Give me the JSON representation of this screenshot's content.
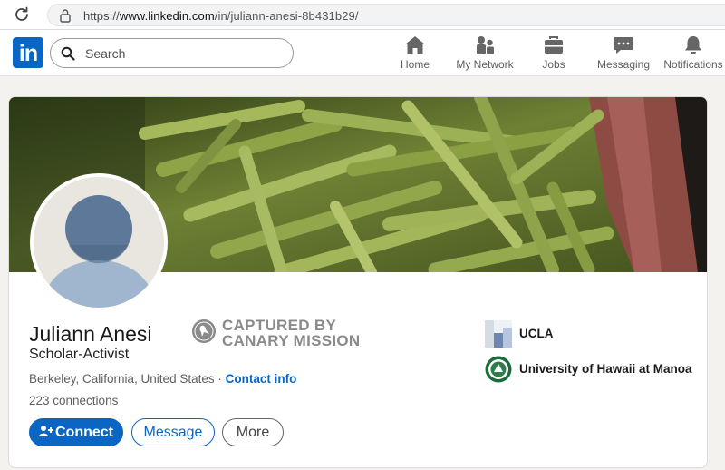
{
  "browser": {
    "url_prefix": "https://",
    "url_host": "www.linkedin.com",
    "url_path": "/in/juliann-anesi-8b431b29/"
  },
  "nav": {
    "logo_text": "in",
    "search_placeholder": "Search",
    "items": [
      {
        "label": "Home",
        "icon": "home-icon"
      },
      {
        "label": "My Network",
        "icon": "people-icon"
      },
      {
        "label": "Jobs",
        "icon": "briefcase-icon"
      },
      {
        "label": "Messaging",
        "icon": "chat-icon"
      },
      {
        "label": "Notifications",
        "icon": "bell-icon"
      }
    ]
  },
  "profile": {
    "name": "Juliann Anesi",
    "headline": "Scholar-Activist",
    "location": "Berkeley, California, United States",
    "separator": " · ",
    "contact_info": "Contact info",
    "connections": "223 connections",
    "buttons": {
      "connect": "Connect",
      "message": "Message",
      "more": "More"
    },
    "education": [
      {
        "name": "UCLA"
      },
      {
        "name": "University of Hawaii at Manoa"
      }
    ]
  },
  "stamp": {
    "line1": "CAPTURED BY",
    "line2": "CANARY MISSION"
  },
  "colors": {
    "brand": "#0a66c2",
    "page_bg": "#f4f2ee",
    "stamp_gray": "#8a8a8a"
  }
}
